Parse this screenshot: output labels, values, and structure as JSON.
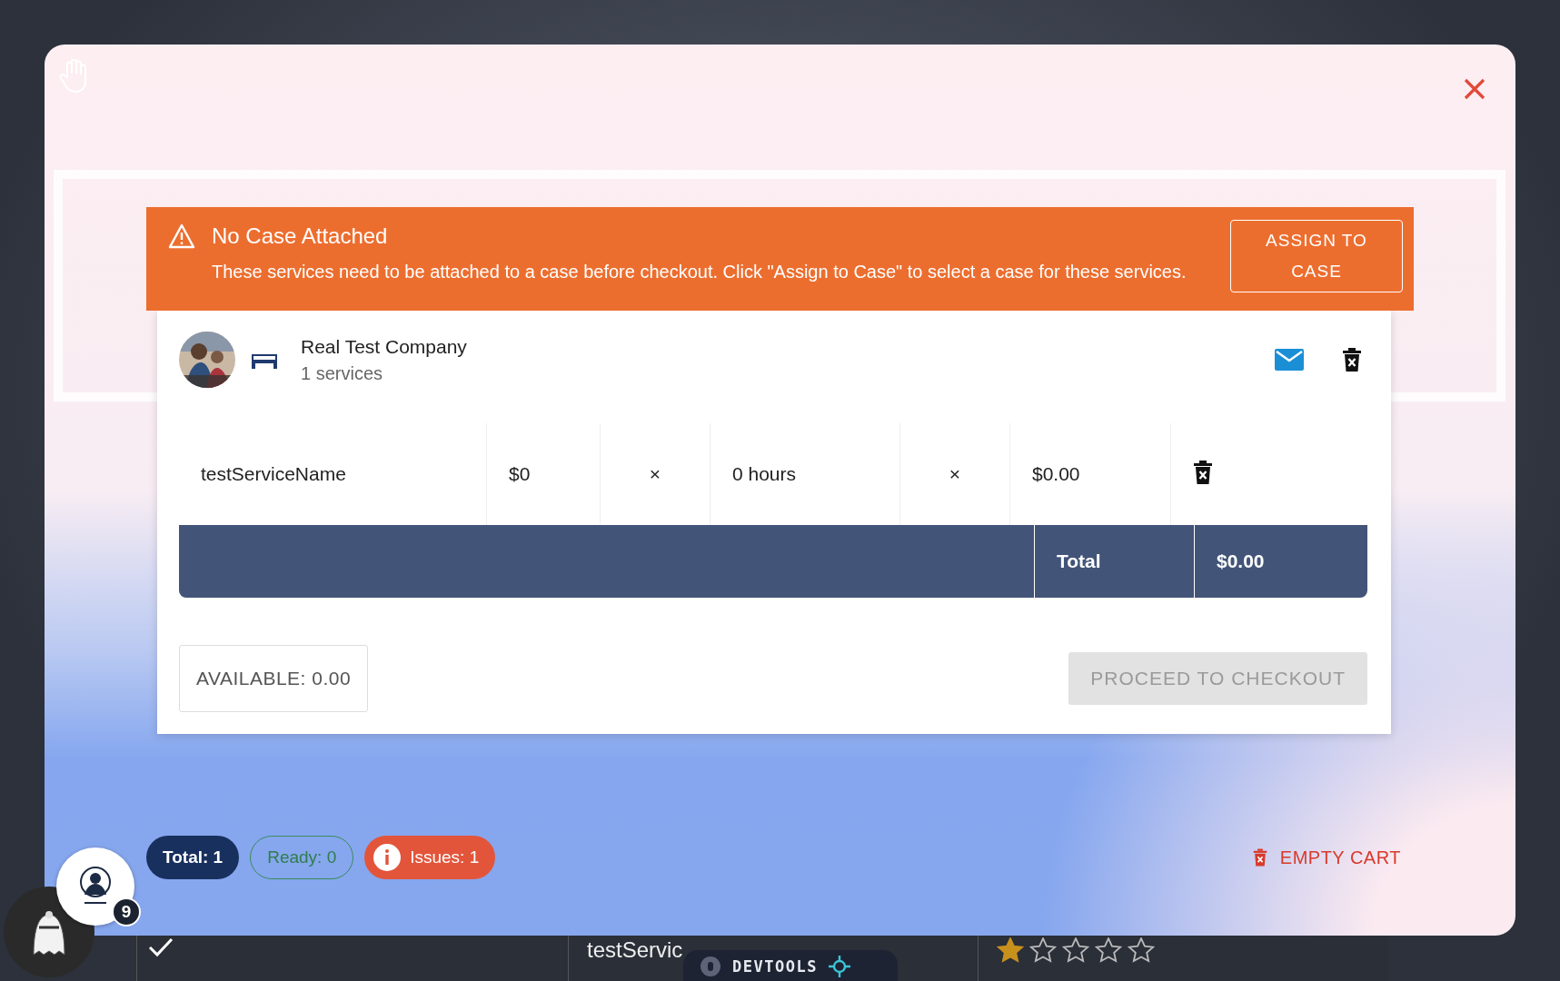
{
  "alert": {
    "title": "No Case Attached",
    "message": "These services need to be attached to a case before checkout. Click \"Assign to Case\" to select a case for these services.",
    "action": "ASSIGN TO CASE"
  },
  "cart": {
    "vendor": "Real Test Company",
    "subtitle": "1 services",
    "items": [
      {
        "name": "testServiceName",
        "rate": "$0",
        "times_1": "×",
        "quantity": "0 hours",
        "times_2": "×",
        "amount": "$0.00"
      }
    ],
    "total_label": "Total",
    "total_value": "$0.00",
    "available": "AVAILABLE: 0.00",
    "checkout": {
      "label": "PROCEED TO CHECKOUT",
      "disabled": true
    }
  },
  "summary": {
    "chips": [
      {
        "kind": "total",
        "label": "Total: 1"
      },
      {
        "kind": "ready",
        "label": "Ready: 0"
      },
      {
        "kind": "issues",
        "label": "Issues: 1"
      }
    ],
    "empty_cart": "EMPTY CART"
  },
  "launcher": {
    "badge": "9"
  },
  "background_table": {
    "row": {
      "available": true,
      "description": "testServic",
      "stars": 1
    }
  },
  "devtools": "DEVTOOLS"
}
